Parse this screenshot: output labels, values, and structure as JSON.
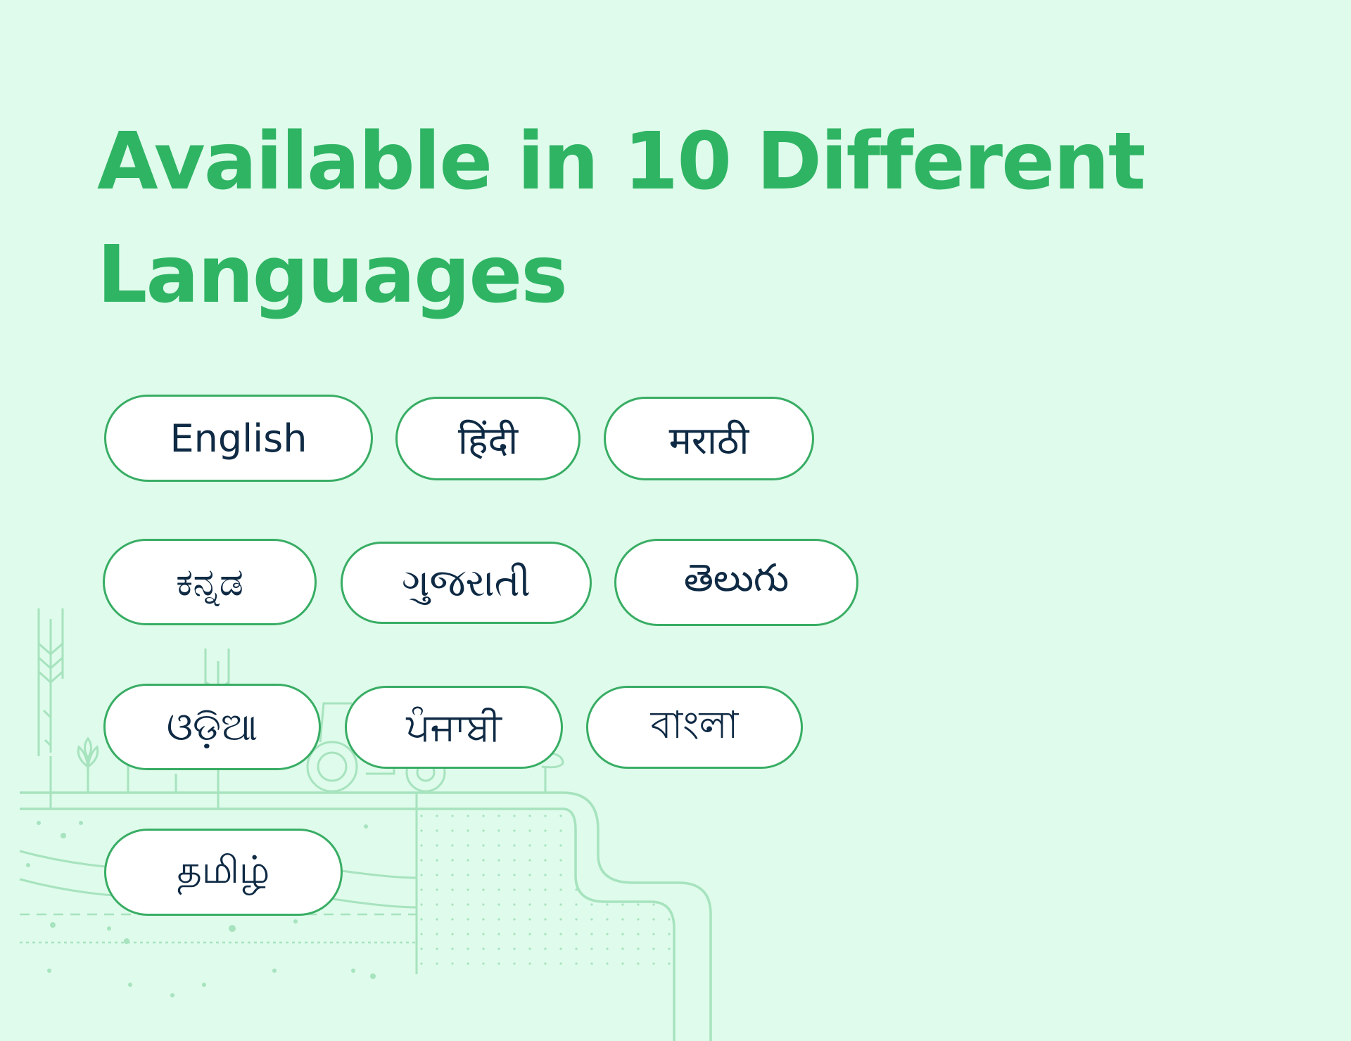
{
  "page": {
    "title_line1": "Available in 10 Different",
    "title_line2": "Languages"
  },
  "languages": [
    {
      "label": "English"
    },
    {
      "label": "हिंदी"
    },
    {
      "label": "मराठी"
    },
    {
      "label": "ಕನ್ನಡ"
    },
    {
      "label": "ગુજરાતી"
    },
    {
      "label": "తెలుగు"
    },
    {
      "label": "ଓଡ଼ିଆ"
    },
    {
      "label": "ਪੰਜਾਬੀ"
    },
    {
      "label": "বাংলা"
    },
    {
      "label": "தமிழ்"
    }
  ],
  "colors": {
    "background": "#dffbeb",
    "accent": "#2fb464",
    "pill_border": "#38ad64",
    "pill_text": "#0f2a44",
    "illustration": "#a6e3be"
  }
}
